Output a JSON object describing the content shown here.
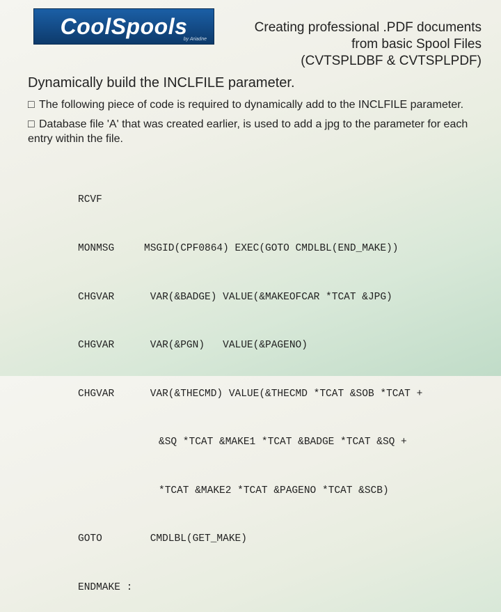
{
  "logo": {
    "part1": "Cool",
    "part2": "Spools",
    "sub": "by Ariadne"
  },
  "title": {
    "line1": "Creating professional .PDF documents",
    "line2": "from basic Spool Files",
    "line3": "(CVTSPLDBF & CVTSPLPDF)"
  },
  "section_title": "Dynamically build the INCLFILE parameter.",
  "bullets": {
    "b1": "The following piece of code is required to dynamically add to the INCLFILE parameter.",
    "b2": "Database file 'A' that was created earlier, is used to add a jpg to the parameter for each entry within the file."
  },
  "code": {
    "r1_cmd": "RCVF",
    "r2_cmd": "MONMSG",
    "r2_arg": "MSGID(CPF0864) EXEC(GOTO CMDLBL(END_MAKE))",
    "r3_cmd": "CHGVAR",
    "r3_arg": " VAR(&BADGE) VALUE(&MAKEOFCAR *TCAT &JPG)",
    "r4_cmd": "CHGVAR",
    "r4_arg": " VAR(&PGN)   VALUE(&PAGENO)",
    "r5_cmd": "CHGVAR",
    "r5_arg": " VAR(&THECMD) VALUE(&THECMD *TCAT &SOB *TCAT +",
    "r5b": "&SQ *TCAT &MAKE1 *TCAT &BADGE *TCAT &SQ +",
    "r5c": "*TCAT &MAKE2 *TCAT &PAGENO *TCAT &SCB)",
    "r6_cmd": "GOTO",
    "r6_arg": " CMDLBL(GET_MAKE)",
    "r7_cmd": "ENDMAKE :"
  }
}
